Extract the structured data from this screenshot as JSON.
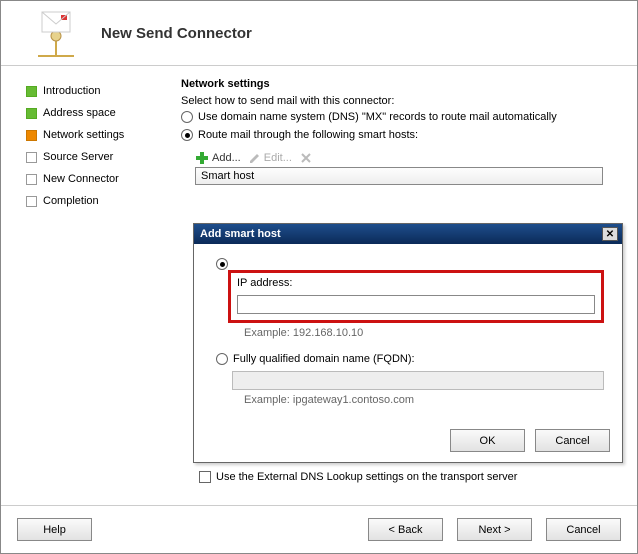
{
  "header": {
    "title": "New Send Connector"
  },
  "sidebar": {
    "items": [
      {
        "label": "Introduction",
        "state": "done"
      },
      {
        "label": "Address space",
        "state": "done"
      },
      {
        "label": "Network settings",
        "state": "current"
      },
      {
        "label": "Source Server",
        "state": "pending"
      },
      {
        "label": "New Connector",
        "state": "pending"
      },
      {
        "label": "Completion",
        "state": "pending"
      }
    ]
  },
  "main": {
    "section_title": "Network settings",
    "subtext": "Select how to send mail with this connector:",
    "opt1": "Use domain name system (DNS) \"MX\" records to route mail automatically",
    "opt2": "Route mail through the following smart hosts:",
    "toolbar": {
      "add": "Add...",
      "edit": "Edit..."
    },
    "col_header": "Smart host",
    "bottom_check": "Use the External DNS Lookup settings on the transport server"
  },
  "dialog": {
    "title": "Add smart host",
    "opt_ip": "IP address:",
    "ip_value": "",
    "example_ip": "Example: 192.168.10.10",
    "opt_fqdn": "Fully qualified domain name (FQDN):",
    "fqdn_value": "",
    "example_fqdn": "Example: ipgateway1.contoso.com",
    "ok": "OK",
    "cancel": "Cancel"
  },
  "footer": {
    "help": "Help",
    "back": "< Back",
    "next": "Next >",
    "cancel": "Cancel"
  }
}
